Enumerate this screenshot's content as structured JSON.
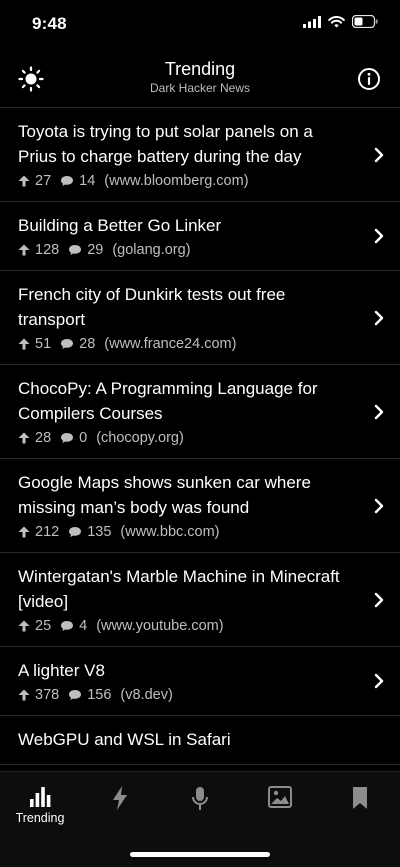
{
  "status": {
    "time": "9:48"
  },
  "nav": {
    "title": "Trending",
    "subtitle": "Dark Hacker News"
  },
  "stories": [
    {
      "title": "Toyota is trying to put solar panels on a Prius to charge battery during the day",
      "points": "27",
      "comments": "14",
      "domain": "(www.bloomberg.com)"
    },
    {
      "title": "Building a Better Go Linker",
      "points": "128",
      "comments": "29",
      "domain": "(golang.org)"
    },
    {
      "title": "French city of Dunkirk tests out free transport",
      "points": "51",
      "comments": "28",
      "domain": "(www.france24.com)"
    },
    {
      "title": "ChocoPy: A Programming Language for Compilers Courses",
      "points": "28",
      "comments": "0",
      "domain": "(chocopy.org)"
    },
    {
      "title": "Google Maps shows sunken car where missing man’s body was found",
      "points": "212",
      "comments": "135",
      "domain": "(www.bbc.com)"
    },
    {
      "title": "Wintergatan's Marble Machine in Minecraft [video]",
      "points": "25",
      "comments": "4",
      "domain": "(www.youtube.com)"
    },
    {
      "title": "A lighter V8",
      "points": "378",
      "comments": "156",
      "domain": "(v8.dev)"
    },
    {
      "title": "WebGPU and WSL in Safari",
      "points": "",
      "comments": "",
      "domain": ""
    }
  ],
  "tabbar": {
    "tabs": [
      {
        "label": "Trending",
        "icon": "bar-chart-icon",
        "active": true
      },
      {
        "label": "",
        "icon": "lightning-icon"
      },
      {
        "label": "",
        "icon": "microphone-icon"
      },
      {
        "label": "",
        "icon": "photo-icon"
      },
      {
        "label": "",
        "icon": "bookmark-icon"
      }
    ]
  },
  "colors": {
    "background": "#000000",
    "text": "#ffffff",
    "meta": "#bfbfbf",
    "divider": "#2a2a2a"
  }
}
